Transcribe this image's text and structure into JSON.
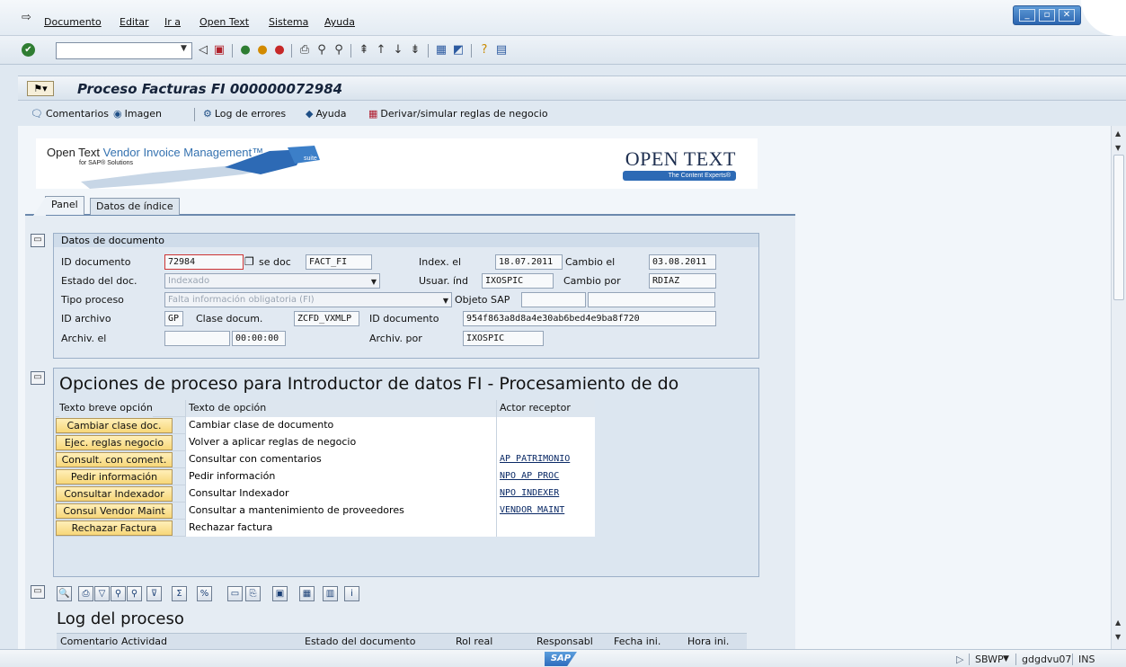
{
  "menu": {
    "items": [
      "Documento",
      "Editar",
      "Ir a",
      "Open Text",
      "Sistema",
      "Ayuda"
    ]
  },
  "toolbar": {
    "command_value": ""
  },
  "screen": {
    "title": "Proceso Facturas FI 000000072984"
  },
  "app_toolbar": {
    "comentarios": "Comentarios",
    "imagen": "Imagen",
    "log_errores": "Log de errores",
    "ayuda": "Ayuda",
    "derivar": "Derivar/simular reglas de negocio"
  },
  "banner": {
    "product_prefix": "Open Text ",
    "product_name": "Vendor Invoice Management™",
    "product_sub": "for SAP® Solutions",
    "logo": "OPEN TEXT",
    "tagline": "The Content Experts®"
  },
  "tabs": [
    "Panel",
    "Datos de índice"
  ],
  "doc": {
    "title": "Datos de documento",
    "labels": {
      "id_documento": "ID documento",
      "clase_doc": "se doc",
      "index_el": "Index. el",
      "cambio_el": "Cambio el",
      "estado": "Estado del doc.",
      "usuar_ind": "Usuar. índ",
      "cambio_por": "Cambio por",
      "tipo_proceso": "Tipo proceso",
      "objeto_sap": "Objeto SAP",
      "id_archivo": "ID archivo",
      "clase_docum": "Clase docum.",
      "id_documento2": "ID documento",
      "archiv_el": "Archiv. el",
      "archiv_por": "Archiv. por"
    },
    "values": {
      "id_documento": "72984",
      "clase_doc": "FACT_FI",
      "index_el": "18.07.2011",
      "cambio_el": "03.08.2011",
      "estado": "Indexado",
      "usuar_ind": "IXOSPIC",
      "cambio_por": "RDIAZ",
      "tipo_proceso": "Falta información obligatoria (FI)",
      "objeto_sap": "",
      "id_archivo": "GP",
      "clase_docum": "ZCFD_VXMLP",
      "id_documento2": "954f863a8d8a4e30ab6bed4e9ba8f720",
      "archiv_el_date": "",
      "archiv_el_time": "00:00:00",
      "archiv_por": "IXOSPIC"
    }
  },
  "options": {
    "title": "Opciones de proceso para Introductor de datos FI - Procesamiento de do",
    "headers": [
      "Texto breve opción",
      "Texto de opción",
      "Actor receptor"
    ],
    "rows": [
      {
        "button": "Cambiar clase doc.",
        "text": "Cambiar clase de documento",
        "actor": ""
      },
      {
        "button": "Ejec. reglas negocio",
        "text": "Volver a aplicar reglas de negocio",
        "actor": ""
      },
      {
        "button": "Consult. con coment.",
        "text": "Consultar con comentarios",
        "actor": "AP PATRIMONIO"
      },
      {
        "button": "Pedir información",
        "text": "Pedir información",
        "actor": "NPO AP PROC"
      },
      {
        "button": "Consultar Indexador",
        "text": "Consultar Indexador",
        "actor": "NPO INDEXER"
      },
      {
        "button": "Consul Vendor Maint",
        "text": "Consultar a mantenimiento de proveedores",
        "actor": "VENDOR MAINT"
      },
      {
        "button": "Rechazar Factura",
        "text": "Rechazar factura",
        "actor": ""
      }
    ]
  },
  "log": {
    "title": "Log del proceso",
    "headers": [
      "Comentario",
      "Actividad",
      "Estado del documento",
      "Rol real",
      "Responsabl",
      "Fecha ini.",
      "Hora ini."
    ]
  },
  "status": {
    "logo": "SAP",
    "system": "SBWP",
    "server": "gdgdvu07",
    "mode": "INS"
  }
}
